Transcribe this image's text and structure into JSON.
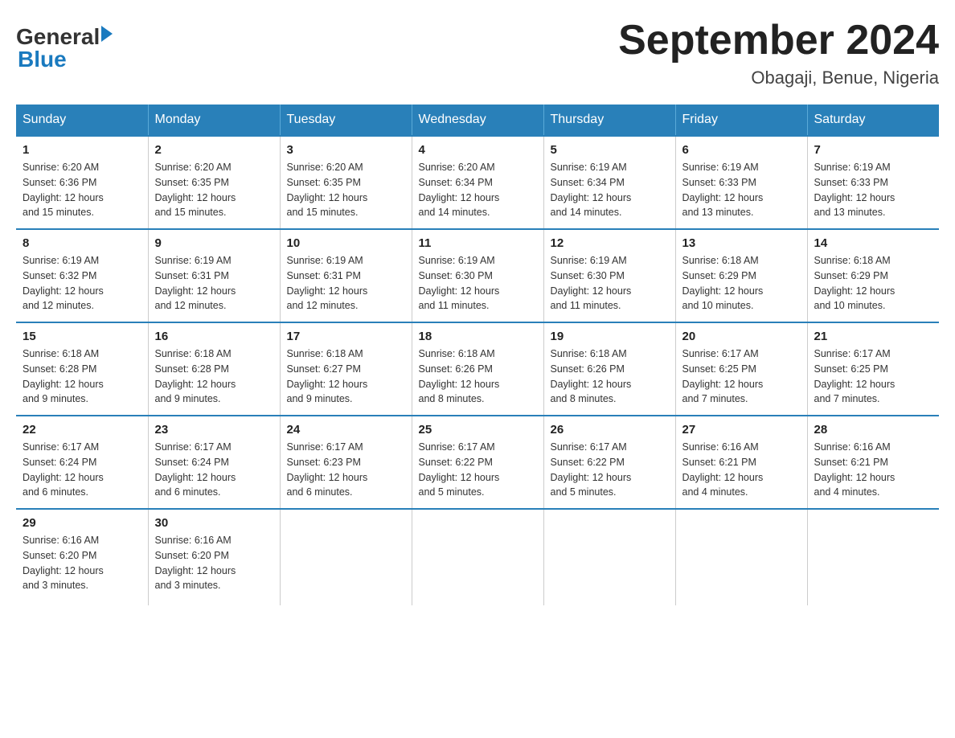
{
  "header": {
    "logo_general": "General",
    "logo_blue": "Blue",
    "month_title": "September 2024",
    "location": "Obagaji, Benue, Nigeria"
  },
  "weekdays": [
    "Sunday",
    "Monday",
    "Tuesday",
    "Wednesday",
    "Thursday",
    "Friday",
    "Saturday"
  ],
  "weeks": [
    [
      {
        "day": "1",
        "sunrise": "6:20 AM",
        "sunset": "6:36 PM",
        "daylight": "12 hours and 15 minutes."
      },
      {
        "day": "2",
        "sunrise": "6:20 AM",
        "sunset": "6:35 PM",
        "daylight": "12 hours and 15 minutes."
      },
      {
        "day": "3",
        "sunrise": "6:20 AM",
        "sunset": "6:35 PM",
        "daylight": "12 hours and 15 minutes."
      },
      {
        "day": "4",
        "sunrise": "6:20 AM",
        "sunset": "6:34 PM",
        "daylight": "12 hours and 14 minutes."
      },
      {
        "day": "5",
        "sunrise": "6:19 AM",
        "sunset": "6:34 PM",
        "daylight": "12 hours and 14 minutes."
      },
      {
        "day": "6",
        "sunrise": "6:19 AM",
        "sunset": "6:33 PM",
        "daylight": "12 hours and 13 minutes."
      },
      {
        "day": "7",
        "sunrise": "6:19 AM",
        "sunset": "6:33 PM",
        "daylight": "12 hours and 13 minutes."
      }
    ],
    [
      {
        "day": "8",
        "sunrise": "6:19 AM",
        "sunset": "6:32 PM",
        "daylight": "12 hours and 12 minutes."
      },
      {
        "day": "9",
        "sunrise": "6:19 AM",
        "sunset": "6:31 PM",
        "daylight": "12 hours and 12 minutes."
      },
      {
        "day": "10",
        "sunrise": "6:19 AM",
        "sunset": "6:31 PM",
        "daylight": "12 hours and 12 minutes."
      },
      {
        "day": "11",
        "sunrise": "6:19 AM",
        "sunset": "6:30 PM",
        "daylight": "12 hours and 11 minutes."
      },
      {
        "day": "12",
        "sunrise": "6:19 AM",
        "sunset": "6:30 PM",
        "daylight": "12 hours and 11 minutes."
      },
      {
        "day": "13",
        "sunrise": "6:18 AM",
        "sunset": "6:29 PM",
        "daylight": "12 hours and 10 minutes."
      },
      {
        "day": "14",
        "sunrise": "6:18 AM",
        "sunset": "6:29 PM",
        "daylight": "12 hours and 10 minutes."
      }
    ],
    [
      {
        "day": "15",
        "sunrise": "6:18 AM",
        "sunset": "6:28 PM",
        "daylight": "12 hours and 9 minutes."
      },
      {
        "day": "16",
        "sunrise": "6:18 AM",
        "sunset": "6:28 PM",
        "daylight": "12 hours and 9 minutes."
      },
      {
        "day": "17",
        "sunrise": "6:18 AM",
        "sunset": "6:27 PM",
        "daylight": "12 hours and 9 minutes."
      },
      {
        "day": "18",
        "sunrise": "6:18 AM",
        "sunset": "6:26 PM",
        "daylight": "12 hours and 8 minutes."
      },
      {
        "day": "19",
        "sunrise": "6:18 AM",
        "sunset": "6:26 PM",
        "daylight": "12 hours and 8 minutes."
      },
      {
        "day": "20",
        "sunrise": "6:17 AM",
        "sunset": "6:25 PM",
        "daylight": "12 hours and 7 minutes."
      },
      {
        "day": "21",
        "sunrise": "6:17 AM",
        "sunset": "6:25 PM",
        "daylight": "12 hours and 7 minutes."
      }
    ],
    [
      {
        "day": "22",
        "sunrise": "6:17 AM",
        "sunset": "6:24 PM",
        "daylight": "12 hours and 6 minutes."
      },
      {
        "day": "23",
        "sunrise": "6:17 AM",
        "sunset": "6:24 PM",
        "daylight": "12 hours and 6 minutes."
      },
      {
        "day": "24",
        "sunrise": "6:17 AM",
        "sunset": "6:23 PM",
        "daylight": "12 hours and 6 minutes."
      },
      {
        "day": "25",
        "sunrise": "6:17 AM",
        "sunset": "6:22 PM",
        "daylight": "12 hours and 5 minutes."
      },
      {
        "day": "26",
        "sunrise": "6:17 AM",
        "sunset": "6:22 PM",
        "daylight": "12 hours and 5 minutes."
      },
      {
        "day": "27",
        "sunrise": "6:16 AM",
        "sunset": "6:21 PM",
        "daylight": "12 hours and 4 minutes."
      },
      {
        "day": "28",
        "sunrise": "6:16 AM",
        "sunset": "6:21 PM",
        "daylight": "12 hours and 4 minutes."
      }
    ],
    [
      {
        "day": "29",
        "sunrise": "6:16 AM",
        "sunset": "6:20 PM",
        "daylight": "12 hours and 3 minutes."
      },
      {
        "day": "30",
        "sunrise": "6:16 AM",
        "sunset": "6:20 PM",
        "daylight": "12 hours and 3 minutes."
      },
      null,
      null,
      null,
      null,
      null
    ]
  ],
  "labels": {
    "sunrise": "Sunrise:",
    "sunset": "Sunset:",
    "daylight": "Daylight:"
  }
}
